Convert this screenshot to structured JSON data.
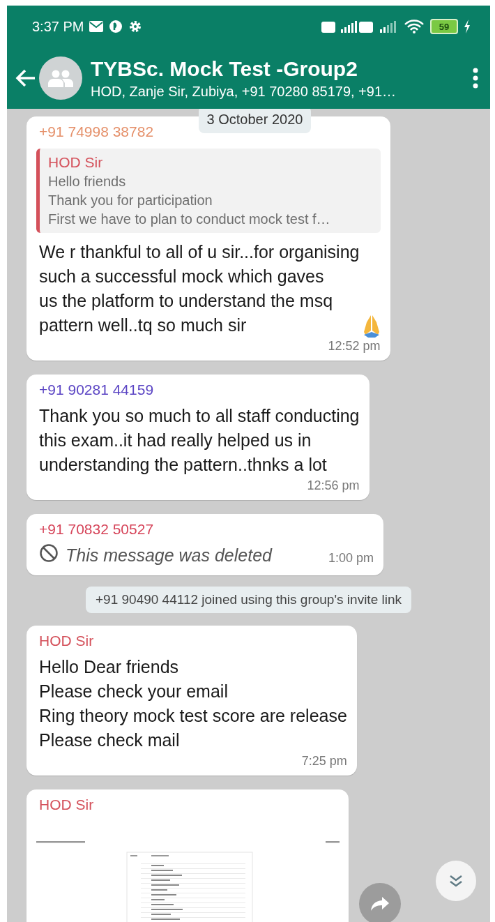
{
  "status_bar": {
    "time": "3:37 PM",
    "battery": "59"
  },
  "header": {
    "title": "TYBSc. Mock Test -Group2",
    "subtitle": "HOD, Zanje Sir, Zubiya, +91 70280 85179, +91…"
  },
  "date_chip": "3 October 2020",
  "messages": [
    {
      "kind": "text",
      "sender": "+91 74998 38782",
      "color": "#e5906a",
      "quote": {
        "sender": "HOD Sir",
        "color": "#d4505a",
        "lines": [
          "Hello friends",
          "Thank you for participation",
          "First we have to plan to conduct mock test f…"
        ]
      },
      "text": "We r thankful to all of u  sir...for organising\nsuch a successful mock which gaves\nus the platform to understand the msq\npattern well..tq so much sir",
      "emoji": {
        "kind": "praying-hands"
      },
      "time": "12:52 pm"
    },
    {
      "kind": "text",
      "sender": "+91 90281 44159",
      "color": "#5b45c4",
      "text": "Thank you so much to all staff conducting\nthis exam..it had really helped us in\nunderstanding the pattern..thnks a lot",
      "time": "12:56 pm"
    },
    {
      "kind": "deleted",
      "sender": "+91 70832 50527",
      "color": "#d6455a",
      "text": "This message was deleted",
      "time": "1:00 pm"
    },
    {
      "kind": "system",
      "text": "+91 90490 44112 joined using this group's invite link"
    },
    {
      "kind": "text",
      "sender": "HOD Sir",
      "color": "#d4505a",
      "text": "Hello Dear friends\nPlease check your email\nRing theory mock test score are release\nPlease check mail",
      "time": "7:25 pm"
    },
    {
      "sender": "HOD Sir",
      "color": "#d4505a"
    }
  ]
}
